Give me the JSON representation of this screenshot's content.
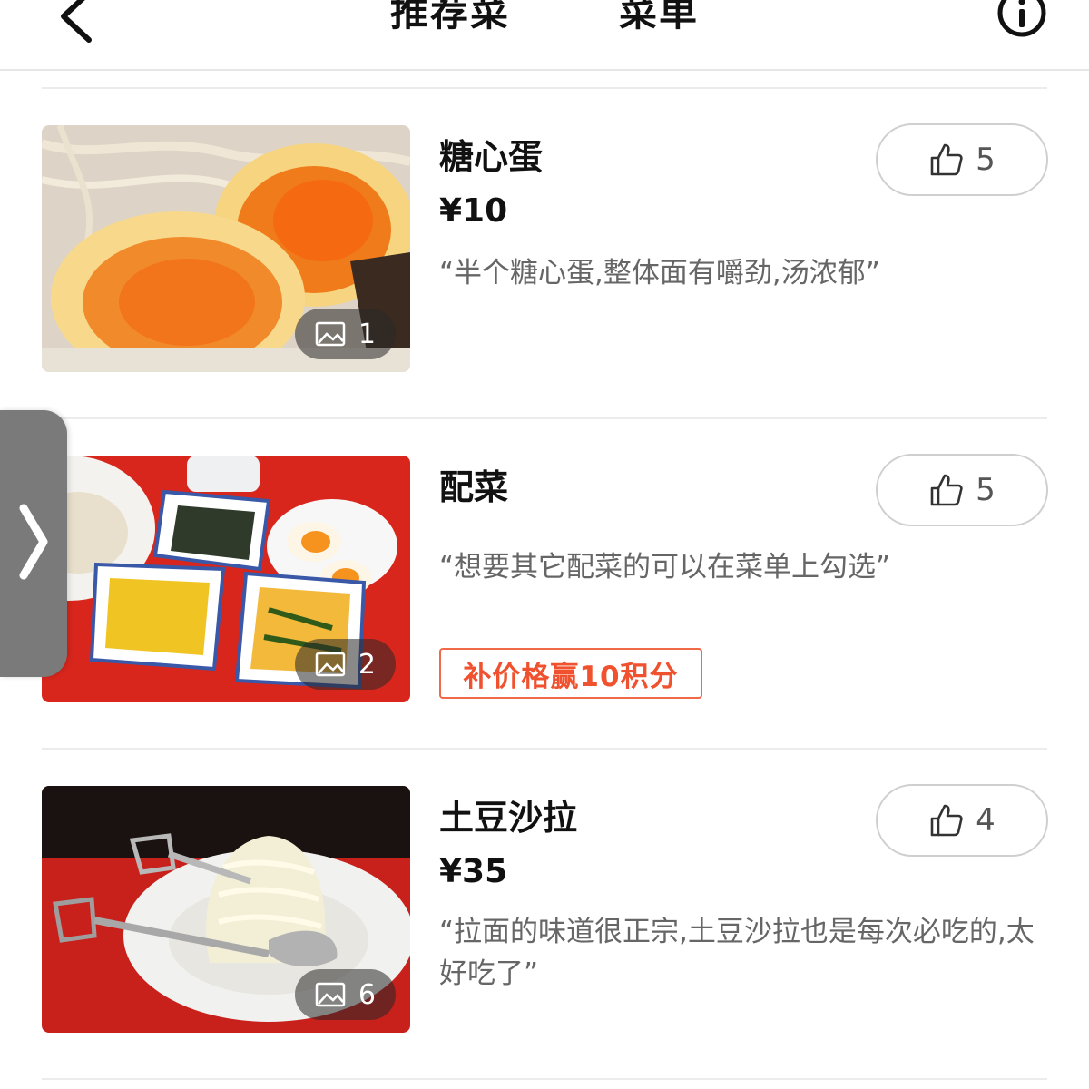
{
  "header": {
    "tabs": [
      {
        "label": "推荐菜",
        "active": true
      },
      {
        "label": "菜单",
        "active": false
      }
    ]
  },
  "dishes": [
    {
      "name": "糖心蛋",
      "price": "¥10",
      "likes": "5",
      "photo_count": "1",
      "quote": "“半个糖心蛋,整体面有嚼劲,汤浓郁”"
    },
    {
      "name": "配菜",
      "likes": "5",
      "photo_count": "2",
      "quote": "“想要其它配菜的可以在菜单上勾选”",
      "promo": "补价格赢10积分"
    },
    {
      "name": "土豆沙拉",
      "price": "¥35",
      "likes": "4",
      "photo_count": "6",
      "quote": "“拉面的味道很正宗,土豆沙拉也是每次必吃的,太好吃了”"
    }
  ],
  "colors": {
    "accent": "#f0512e",
    "tab_underline_start": "#ff3d2e",
    "tab_underline_end": "#ffb15a"
  },
  "icons": [
    "back-arrow-icon",
    "info-icon",
    "thumbs-up-icon",
    "image-icon",
    "chevron-right-icon"
  ]
}
